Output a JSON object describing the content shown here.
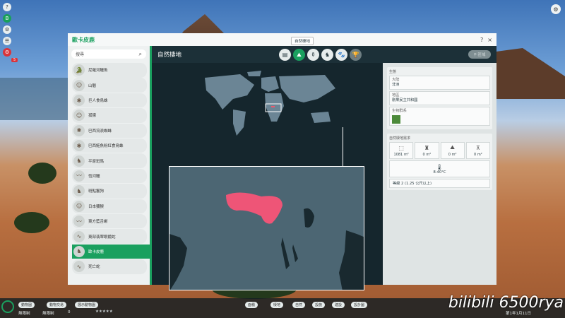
{
  "hud": {
    "left_buttons": [
      "?",
      "B",
      "⚙",
      "☰",
      "⚙"
    ],
    "red_badge": "5",
    "top_right_button": "⚙"
  },
  "window": {
    "title": "歐卡皮鹿",
    "tooltip": "自然棲地",
    "controls": [
      "?",
      "×"
    ]
  },
  "list": {
    "search_placeholder": "搜尋",
    "items": [
      {
        "label": "尼羅河鱷魚",
        "icon": "crocodile-icon"
      },
      {
        "label": "山魈",
        "icon": "mandrill-icon"
      },
      {
        "label": "巨人食鳥蛛",
        "icon": "spider-icon"
      },
      {
        "label": "孤獴",
        "icon": "meerkat-icon"
      },
      {
        "label": "巴西流浪蜘蛛",
        "icon": "spider-icon"
      },
      {
        "label": "巴西鮭魚粉紅食鳥蛛",
        "icon": "spider-icon"
      },
      {
        "label": "平原斑馬",
        "icon": "zebra-icon"
      },
      {
        "label": "恆河鱷",
        "icon": "gharial-icon"
      },
      {
        "label": "斑點鬣狗",
        "icon": "hyena-icon"
      },
      {
        "label": "日本獼猴",
        "icon": "macaque-icon"
      },
      {
        "label": "東方藍舌蜥",
        "icon": "lizard-icon"
      },
      {
        "label": "東部翡翠眼鏡蛇",
        "icon": "snake-icon"
      },
      {
        "label": "歐卡皮鹿",
        "icon": "okapi-icon",
        "selected": true
      },
      {
        "label": "死亡蛇",
        "icon": "snake-icon"
      }
    ]
  },
  "main": {
    "title": "自然棲地",
    "tabs": [
      {
        "name": "tab-info",
        "glyph": "▤"
      },
      {
        "name": "tab-habitat",
        "glyph": "⛰",
        "active": true
      },
      {
        "name": "tab-diet",
        "glyph": "⚱"
      },
      {
        "name": "tab-breeding",
        "glyph": "♞"
      },
      {
        "name": "tab-social",
        "glyph": "🐾"
      },
      {
        "name": "tab-trophy",
        "glyph": "🏆",
        "dim": true
      }
    ]
  },
  "right": {
    "button_label": "⚲ 區域",
    "ecosystem_title": "生態",
    "continent_label": "大陸",
    "continent_value": "非洲",
    "region_label": "地區",
    "region_value": "剛果民主共和國",
    "biome_label": "生物群系",
    "requirements_title": "自然棲地需求",
    "req": [
      {
        "glyph": "⬚",
        "value": "1081 m²"
      },
      {
        "glyph": "♜",
        "value": "0 m²"
      },
      {
        "glyph": "⛰",
        "value": "0 m²"
      },
      {
        "glyph": "⊼",
        "value": "0 m²"
      }
    ],
    "temp_glyph": "🌡",
    "temp_value": "8-40°C",
    "grade": "等級 2 (1.25 公尺以上)"
  },
  "bottom": {
    "pills": [
      "動物園",
      "動物交易",
      "展示動物園"
    ],
    "status_left": [
      "無限制",
      "無限制"
    ],
    "money": "0",
    "nav": [
      "面積",
      "棲地",
      "自然",
      "設施",
      "建設",
      "設計圖"
    ],
    "date": "第1年1月11日"
  },
  "watermark": "bilibili 6500rya"
}
